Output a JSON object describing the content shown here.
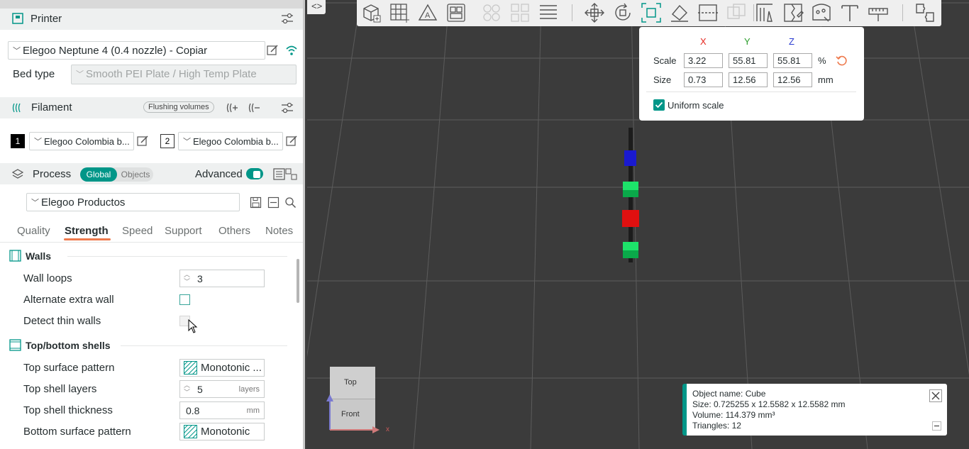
{
  "printer": {
    "title": "Printer",
    "profile": "Elegoo Neptune 4 (0.4 nozzle) - Copiar",
    "bed_type_label": "Bed type",
    "bed_type_value": "Smooth PEI Plate / High Temp Plate"
  },
  "filament": {
    "title": "Filament",
    "flushing_button": "Flushing volumes",
    "slots": [
      {
        "index": "1",
        "name": "Elegoo Colombia b..."
      },
      {
        "index": "2",
        "name": "Elegoo Colombia b..."
      }
    ]
  },
  "process": {
    "title": "Process",
    "toggle_global": "Global",
    "toggle_objects": "Objects",
    "advanced_label": "Advanced",
    "preset": "Elegoo Productos",
    "tabs": [
      "Quality",
      "Strength",
      "Speed",
      "Support",
      "Others",
      "Notes"
    ],
    "active_tab": "Strength"
  },
  "walls": {
    "title": "Walls",
    "wall_loops_label": "Wall loops",
    "wall_loops_value": "3",
    "alternate_label": "Alternate extra wall",
    "detect_thin_label": "Detect thin walls"
  },
  "shells": {
    "title": "Top/bottom shells",
    "top_pattern_label": "Top surface pattern",
    "top_pattern_value": "Monotonic ...",
    "top_layers_label": "Top shell layers",
    "top_layers_value": "5",
    "top_layers_unit": "layers",
    "top_thickness_label": "Top shell thickness",
    "top_thickness_value": "0.8",
    "top_thickness_unit": "mm",
    "bottom_pattern_label": "Bottom surface pattern",
    "bottom_pattern_value": "Monotonic"
  },
  "scale_panel": {
    "axis_x": "X",
    "axis_y": "Y",
    "axis_z": "Z",
    "scale_label": "Scale",
    "scale_x": "3.22",
    "scale_y": "55.81",
    "scale_z": "55.81",
    "scale_unit": "%",
    "size_label": "Size",
    "size_x": "0.73",
    "size_y": "12.56",
    "size_z": "12.56",
    "size_unit": "mm",
    "uniform_label": "Uniform scale"
  },
  "object_info": {
    "name": "Object name: Cube",
    "size": "Size: 0.725255 x 12.5582 x 12.5582 mm",
    "volume": "Volume: 114.379 mm³",
    "triangles": "Triangles: 12"
  },
  "view_cube": {
    "top": "Top",
    "front": "Front",
    "axis_x": "x"
  },
  "colors": {
    "accent": "#009688",
    "tab_underline": "#ee7a4d",
    "axis_x": "#e5261f",
    "axis_y": "#2a9d2a",
    "axis_z": "#2a3bd0"
  }
}
